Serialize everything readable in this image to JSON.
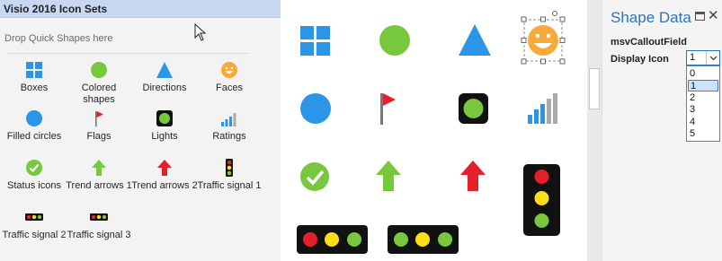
{
  "stencil": {
    "title": "Visio 2016 Icon Sets",
    "quick_shapes_hint": "Drop Quick Shapes here",
    "items": [
      {
        "label": "Boxes",
        "icon": "boxes-icon"
      },
      {
        "label": "Colored\nshapes",
        "icon": "colored-shapes-icon"
      },
      {
        "label": "Directions",
        "icon": "directions-icon"
      },
      {
        "label": "Faces",
        "icon": "faces-icon"
      },
      {
        "label": "Filled circles",
        "icon": "filled-circles-icon"
      },
      {
        "label": "Flags",
        "icon": "flags-icon"
      },
      {
        "label": "Lights",
        "icon": "lights-icon"
      },
      {
        "label": "Ratings",
        "icon": "ratings-icon"
      },
      {
        "label": "Status icons",
        "icon": "status-icons-icon"
      },
      {
        "label": "Trend arrows 1",
        "icon": "trend-arrows-1-icon"
      },
      {
        "label": "Trend arrows 2",
        "icon": "trend-arrows-2-icon"
      },
      {
        "label": "Traffic signal 1",
        "icon": "traffic-signal-1-icon"
      },
      {
        "label": "Traffic signal 2",
        "icon": "traffic-signal-2-icon"
      },
      {
        "label": "Traffic signal 3",
        "icon": "traffic-signal-3-icon"
      }
    ]
  },
  "shape_data": {
    "title": "Shape Data",
    "fields": [
      {
        "label": "msvCalloutField",
        "value": ""
      },
      {
        "label": "Display Icon",
        "value": "1"
      }
    ],
    "dropdown_options": [
      "0",
      "1",
      "2",
      "3",
      "4",
      "5"
    ],
    "selected_option": "1"
  },
  "colors": {
    "blue": "#2b96e8",
    "green": "#77c83c",
    "red": "#e5202a",
    "yellow": "#ffde17",
    "orange": "#f7a93a",
    "header": "#c8d7f2"
  }
}
